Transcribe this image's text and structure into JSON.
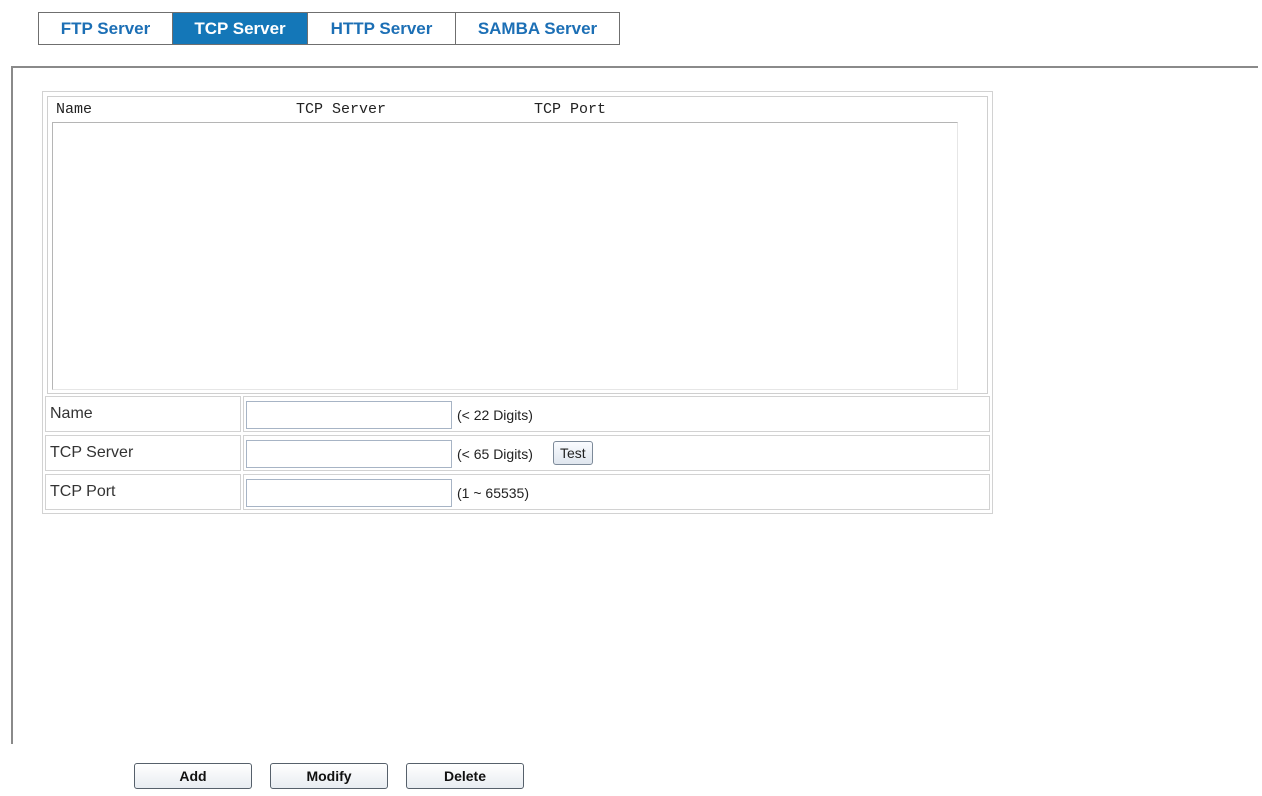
{
  "tabs": [
    {
      "label": "FTP Server",
      "active": false
    },
    {
      "label": "TCP Server",
      "active": true
    },
    {
      "label": "HTTP Server",
      "active": false
    },
    {
      "label": "SAMBA Server",
      "active": false
    }
  ],
  "list": {
    "columns": [
      "Name",
      "TCP Server",
      "TCP Port"
    ],
    "rows": []
  },
  "form": {
    "name": {
      "label": "Name",
      "value": "",
      "hint": "(< 22 Digits)"
    },
    "tcp_server": {
      "label": "TCP Server",
      "value": "",
      "hint": "(< 65 Digits)",
      "test_label": "Test"
    },
    "tcp_port": {
      "label": "TCP Port",
      "value": "",
      "hint": "(1 ~ 65535)"
    }
  },
  "actions": {
    "add_label": "Add",
    "modify_label": "Modify",
    "delete_label": "Delete"
  },
  "colors": {
    "tab_active_bg": "#1477b8",
    "tab_text": "#1c6fb5"
  }
}
